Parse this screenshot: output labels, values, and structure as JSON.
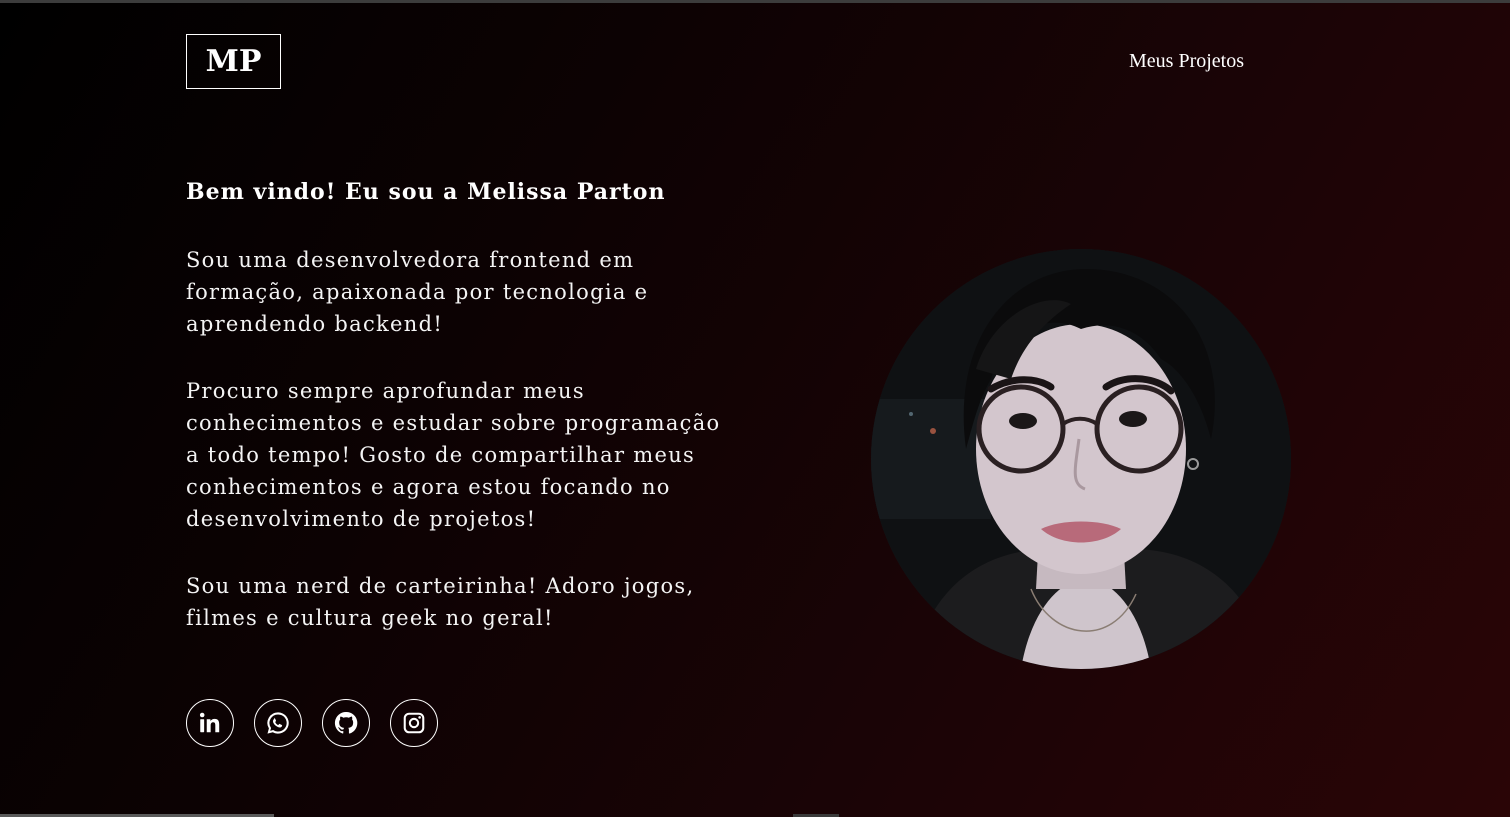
{
  "header": {
    "logo_text": "MP",
    "nav_projects_label": "Meus Projetos"
  },
  "intro": {
    "heading": "Bem vindo! Eu sou a Melissa Parton",
    "paragraphs": [
      "Sou uma desenvolvedora frontend em formação, apaixonada por tecnologia e aprendendo backend!",
      "Procuro sempre aprofundar meus conhecimentos e estudar sobre programação a todo tempo! Gosto de compartilhar meus conhecimentos e agora estou focando no desenvolvimento de projetos!",
      "Sou uma nerd de carteirinha! Adoro jogos, filmes e cultura geek no geral!"
    ]
  },
  "socials": [
    {
      "icon": "linkedin-icon"
    },
    {
      "icon": "whatsapp-icon"
    },
    {
      "icon": "github-icon"
    },
    {
      "icon": "instagram-icon"
    }
  ],
  "profile_photo": {
    "shape": "circle"
  },
  "colors": {
    "background_start": "#000000",
    "background_end": "#2a0506",
    "text": "#ffffff"
  }
}
